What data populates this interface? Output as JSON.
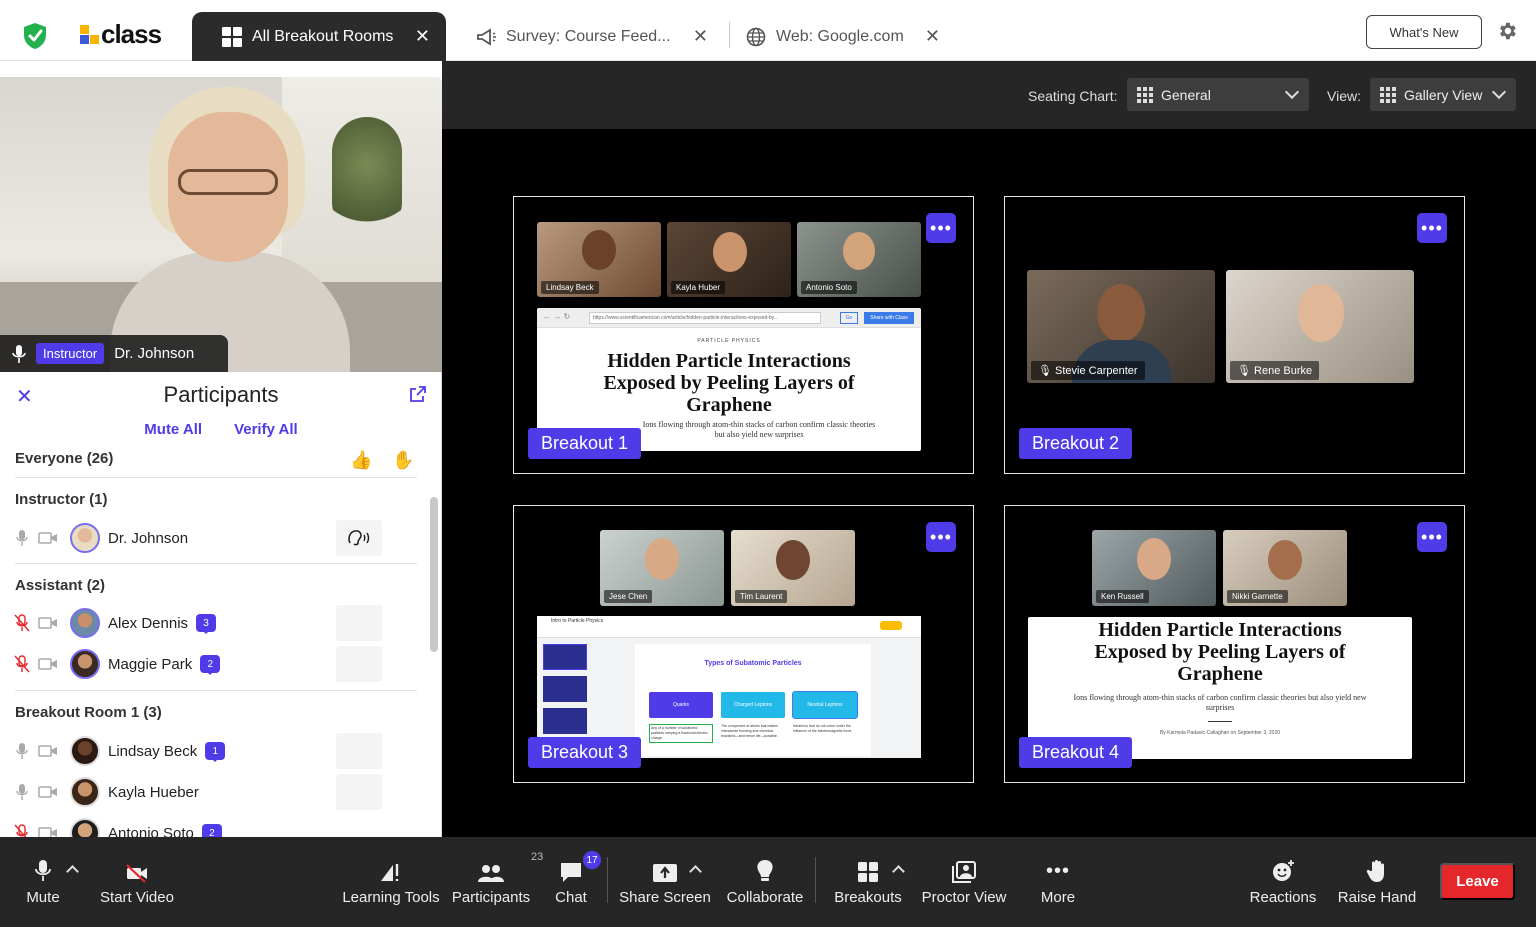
{
  "app": {
    "logo_text": "class"
  },
  "tabs": [
    {
      "label": "All Breakout Rooms",
      "active": true
    },
    {
      "label": "Survey: Course Feed...",
      "active": false
    },
    {
      "label": "Web: Google.com",
      "active": false
    }
  ],
  "topbar": {
    "whats_new": "What's New"
  },
  "instructor_video": {
    "badge": "Instructor",
    "name": "Dr. Johnson"
  },
  "participants": {
    "title": "Participants",
    "mute_all": "Mute All",
    "verify_all": "Verify All",
    "everyone": "Everyone (26)",
    "groups": {
      "instructor": "Instructor (1)",
      "assistant": "Assistant (2)",
      "breakout1": "Breakout Room 1 (3)"
    },
    "rows": [
      {
        "name": "Dr. Johnson",
        "chat": ""
      },
      {
        "name": "Alex Dennis",
        "chat": "3"
      },
      {
        "name": "Maggie Park",
        "chat": "2"
      },
      {
        "name": "Lindsay Beck",
        "chat": "1"
      },
      {
        "name": "Kayla Hueber",
        "chat": ""
      },
      {
        "name": "Antonio Soto",
        "chat": "2"
      }
    ]
  },
  "toolbar": {
    "seating_label": "Seating Chart:",
    "seating_value": "General",
    "view_label": "View:",
    "view_value": "Gallery View"
  },
  "rooms": [
    {
      "label": "Breakout 1",
      "participants": [
        "Lindsay Beck",
        "Kayla Huber",
        "Antonio Soto"
      ],
      "url": "https://www.scientificamerican.com/article/hidden-particle-interactions-exposed-by...",
      "kicker": "PARTICLE PHYSICS",
      "headline": "Hidden Particle Interactions Exposed by Peeling Layers of Graphene",
      "subhead": "Ions flowing through atom-thin stacks of carbon confirm classic theories but also yield new surprises",
      "go_label": "Go",
      "share_label": "Share with Class"
    },
    {
      "label": "Breakout 2",
      "participants": [
        "Stevie Carpenter",
        "Rene Burke"
      ]
    },
    {
      "label": "Breakout 3",
      "participants": [
        "Jese Chen",
        "Tim Laurent"
      ],
      "doc_title": "Intro to Particle Physics",
      "slide_title": "Types of Subatomic Particles",
      "boxes": [
        "Quarks",
        "Charged Leptons",
        "Neutral Leptons"
      ],
      "notes": [
        "Any of a number of subatomic particles carrying a fractional electric charge.",
        "The component of atoms that makes interatomic bonding and chemical reactions—and hence life—possible.",
        "Neutrinos that do not come under the influence of the electromagnetic force."
      ]
    },
    {
      "label": "Breakout 4",
      "participants": [
        "Ken Russell",
        "Nikki Garnette"
      ],
      "headline": "Hidden Particle Interactions Exposed by Peeling Layers of Graphene",
      "subhead": "Ions flowing through atom-thin stacks of carbon confirm classic theories but also yield new surprises",
      "byline": "By Karmela Padavic-Callaghan on September 3, 2020"
    }
  ],
  "bottombar": {
    "mute": "Mute",
    "start_video": "Start Video",
    "learning_tools": "Learning Tools",
    "participants": "Participants",
    "participants_count": "23",
    "chat": "Chat",
    "chat_count": "17",
    "share_screen": "Share Screen",
    "collaborate": "Collaborate",
    "breakouts": "Breakouts",
    "proctor_view": "Proctor View",
    "more": "More",
    "reactions": "Reactions",
    "raise_hand": "Raise Hand",
    "leave": "Leave"
  },
  "colors": {
    "accent": "#4f3ce8",
    "leave": "#e5262a",
    "shield": "#22b14c",
    "dark": "#262626"
  }
}
